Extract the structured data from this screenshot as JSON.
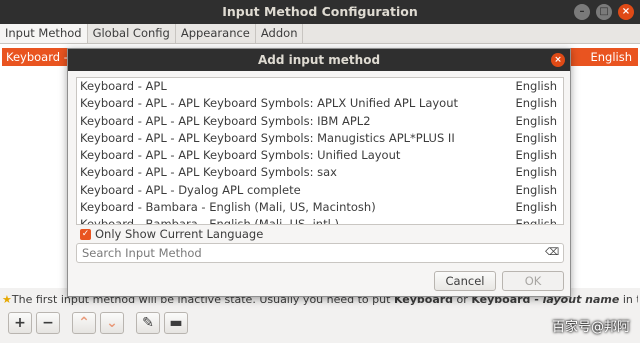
{
  "window": {
    "title": "Input Method Configuration",
    "controls": [
      "–",
      "□",
      "×"
    ]
  },
  "tabs": [
    "Input Method",
    "Global Config",
    "Appearance",
    "Addon"
  ],
  "selected_row": {
    "name": "Keyboard - E",
    "language": "English"
  },
  "hint": {
    "star": "★",
    "part1": "The first input method will be inactive state. Usually you need to put ",
    "bold1": "Keyboard",
    "part2": " or ",
    "bold2": "Keyboard - ",
    "italic": "layout name",
    "part3": " in the first place."
  },
  "tools": {
    "add": "+",
    "remove": "−",
    "up": "⌃",
    "down": "⌄",
    "configure": "✎",
    "keyboard": "▬"
  },
  "watermark": "百家号@邦阿",
  "dialog": {
    "title": "Add input method",
    "close": "×",
    "items": [
      {
        "name": "Keyboard - APL",
        "language": "English"
      },
      {
        "name": "Keyboard - APL - APL Keyboard Symbols: APLX Unified APL Layout",
        "language": "English"
      },
      {
        "name": "Keyboard - APL - APL Keyboard Symbols: IBM APL2",
        "language": "English"
      },
      {
        "name": "Keyboard - APL - APL Keyboard Symbols: Manugistics APL*PLUS II",
        "language": "English"
      },
      {
        "name": "Keyboard - APL - APL Keyboard Symbols: Unified Layout",
        "language": "English"
      },
      {
        "name": "Keyboard - APL - APL Keyboard Symbols: sax",
        "language": "English"
      },
      {
        "name": "Keyboard - APL - Dyalog APL complete",
        "language": "English"
      },
      {
        "name": "Keyboard - Bambara - English (Mali, US, Macintosh)",
        "language": "English"
      },
      {
        "name": "Keyboard - Bambara - English (Mali, US, intl.)",
        "language": "English"
      }
    ],
    "only_current_language": "Only Show Current Language",
    "checked_mark": "✓",
    "search_placeholder": "Search Input Method",
    "clear_glyph": "⌫",
    "cancel_label": "Cancel",
    "ok_label": "OK"
  },
  "colors": {
    "accent": "#e95420",
    "titlebar": "#2f2f2f"
  }
}
